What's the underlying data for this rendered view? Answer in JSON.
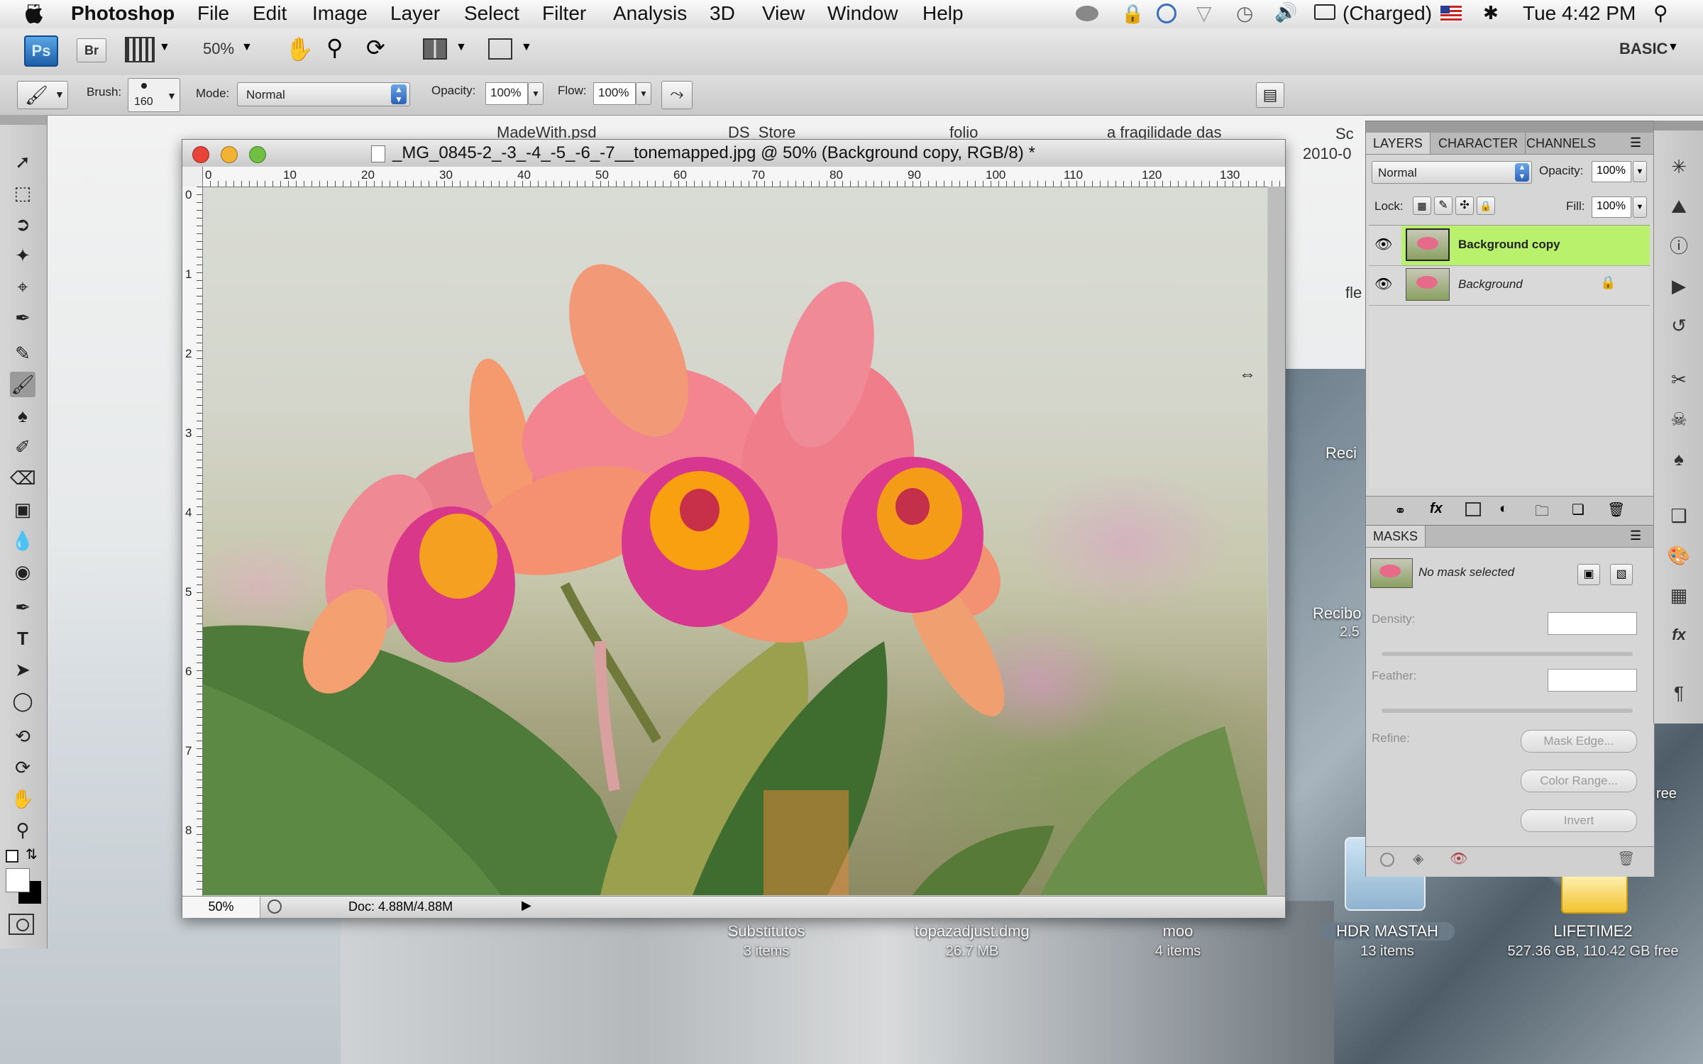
{
  "menubar": {
    "app_name": "Photoshop",
    "items": [
      "File",
      "Edit",
      "Image",
      "Layer",
      "Select",
      "Filter",
      "Analysis",
      "3D",
      "View",
      "Window",
      "Help"
    ],
    "battery": "(Charged)",
    "clock": "Tue 4:42 PM"
  },
  "appbar": {
    "ps_logo": "Ps",
    "br_logo": "Br",
    "zoom": "50%",
    "workspace": "BASIC"
  },
  "options": {
    "brush_label": "Brush:",
    "brush_size": "160",
    "mode_label": "Mode:",
    "mode_value": "Normal",
    "opacity_label": "Opacity:",
    "opacity_value": "100%",
    "flow_label": "Flow:",
    "flow_value": "100%"
  },
  "document": {
    "title": "_MG_0845-2_-3_-4_-5_-6_-7__tonemapped.jpg @ 50% (Background copy, RGB/8) *",
    "ruler_h": [
      "0",
      "10",
      "20",
      "30",
      "40",
      "50",
      "60",
      "70",
      "80",
      "90",
      "100",
      "110",
      "120",
      "130"
    ],
    "ruler_v": [
      "0",
      "1",
      "2",
      "3",
      "4",
      "5",
      "6",
      "7",
      "8"
    ],
    "status_zoom": "50%",
    "doc_size": "Doc: 4.88M/4.88M"
  },
  "layers_panel": {
    "tabs": [
      "LAYERS",
      "CHARACTER",
      "CHANNELS"
    ],
    "blend_mode": "Normal",
    "opacity_label": "Opacity:",
    "opacity_value": "100%",
    "lock_label": "Lock:",
    "fill_label": "Fill:",
    "fill_value": "100%",
    "layers": [
      {
        "name": "Background copy",
        "selected": true
      },
      {
        "name": "Background",
        "selected": false
      }
    ]
  },
  "masks_panel": {
    "title": "MASKS",
    "status": "No mask selected",
    "density_label": "Density:",
    "feather_label": "Feather:",
    "refine_label": "Refine:",
    "mask_edge": "Mask Edge...",
    "color_range": "Color Range...",
    "invert": "Invert"
  },
  "desktop": {
    "top_labels": [
      "MadeWith.psd",
      "DS_Store",
      "folio",
      "a fragilidade das"
    ],
    "side_labels": [
      "Sc",
      "2010-0",
      "fle",
      "Reci",
      "Recibo",
      "2.5",
      "ree"
    ],
    "icons": [
      {
        "name": "Substitutos",
        "sub": "3 items"
      },
      {
        "name": "topazadjust.dmg",
        "sub": "26.7 MB"
      },
      {
        "name": "moo",
        "sub": "4 items"
      },
      {
        "name": "HDR MASTAH",
        "sub": "13 items"
      },
      {
        "name": "LIFETIME2",
        "sub": "527.36 GB, 110.42 GB free"
      }
    ]
  },
  "colors": {
    "selected_layer": "#b9f06c",
    "close": "#e8443a",
    "minimize": "#f2b233",
    "zoom": "#6fc041"
  }
}
